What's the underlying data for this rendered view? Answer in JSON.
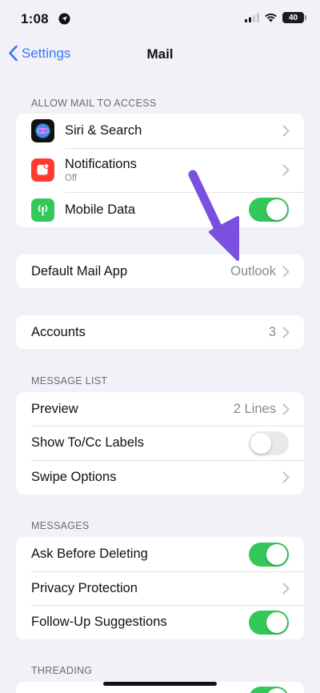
{
  "status": {
    "time": "1:08",
    "battery": "40"
  },
  "nav": {
    "back_label": "Settings",
    "title": "Mail"
  },
  "sections": {
    "access": {
      "header": "ALLOW MAIL TO ACCESS",
      "rows": [
        {
          "label": "Siri & Search",
          "icon": "siri-icon"
        },
        {
          "label": "Notifications",
          "sublabel": "Off",
          "icon": "notifications-icon",
          "icon_color": "#ff3b30"
        },
        {
          "label": "Mobile Data",
          "icon": "antenna-icon",
          "icon_color": "#34c759",
          "toggle": true
        }
      ]
    },
    "default_app": {
      "label": "Default Mail App",
      "value": "Outlook"
    },
    "accounts": {
      "label": "Accounts",
      "value": "3"
    },
    "message_list": {
      "header": "MESSAGE LIST",
      "rows": [
        {
          "label": "Preview",
          "value": "2 Lines"
        },
        {
          "label": "Show To/Cc Labels",
          "toggle": false
        },
        {
          "label": "Swipe Options"
        }
      ]
    },
    "messages": {
      "header": "MESSAGES",
      "rows": [
        {
          "label": "Ask Before Deleting",
          "toggle": true
        },
        {
          "label": "Privacy Protection"
        },
        {
          "label": "Follow-Up Suggestions",
          "toggle": true
        }
      ]
    },
    "threading": {
      "header": "THREADING"
    }
  },
  "colors": {
    "accent": "#3478f6",
    "toggle_on": "#34c759",
    "annotation_arrow": "#7b4fe0"
  }
}
